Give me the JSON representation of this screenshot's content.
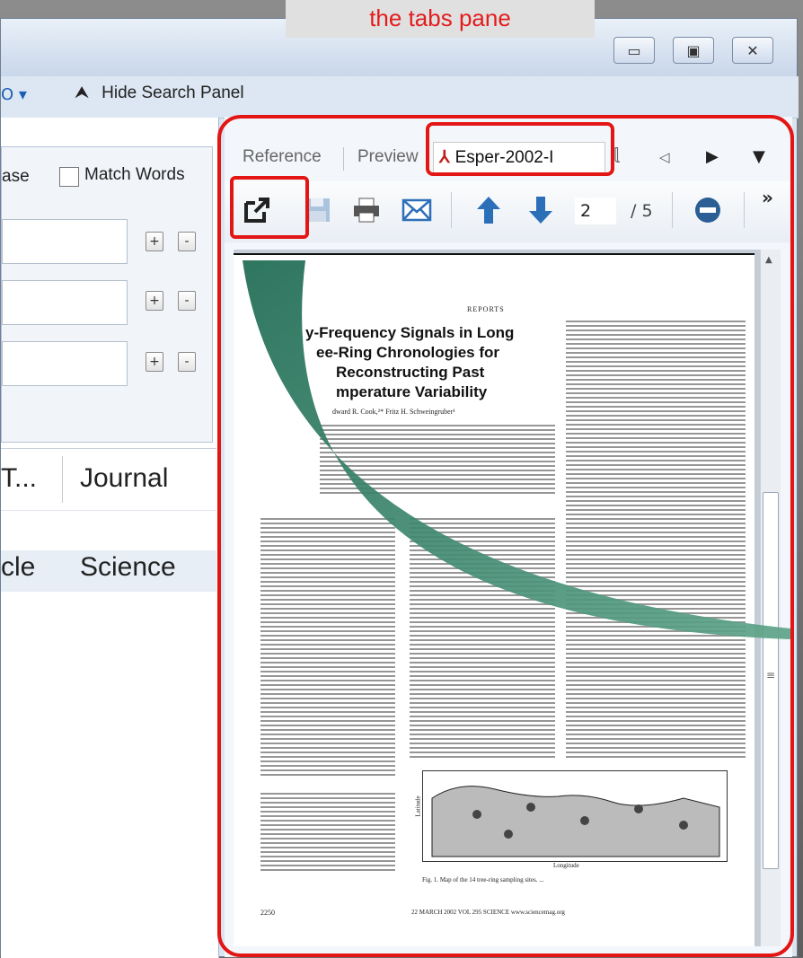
{
  "callout": {
    "text": "the tabs pane"
  },
  "window": {
    "controls": [
      "minimize",
      "restore",
      "close"
    ]
  },
  "searchbar": {
    "hide_label": "Hide Search Panel"
  },
  "search_options": {
    "partial_label": "ase",
    "match_words": "Match Words",
    "match_words_checked": false
  },
  "search_fields": [
    {
      "value": ""
    },
    {
      "value": ""
    },
    {
      "value": ""
    }
  ],
  "table": {
    "columns": [
      "T...",
      "Journal"
    ],
    "rows": [
      {
        "type": "cle",
        "journal": "Science"
      }
    ]
  },
  "tabs": [
    {
      "label": "Reference",
      "active": false
    },
    {
      "label": "Preview",
      "active": false
    },
    {
      "label": "Esper-2002-I",
      "active": true
    }
  ],
  "toolbar": {
    "open_external": "open-external-icon",
    "save": "save-icon",
    "print": "print-icon",
    "email": "email-icon",
    "prev": "arrow-up-icon",
    "next": "arrow-down-icon",
    "page_current": "2",
    "page_total": "/ 5",
    "more": "»"
  },
  "pdf": {
    "section": "REPORTS",
    "title_lines": [
      "y-Frequency Signals in Long",
      "ee-Ring Chronologies for",
      "Reconstructing Past",
      "mperature Variability"
    ],
    "authors": "dward R. Cook,²* Fritz H. Schweingruber¹",
    "footer_page": "2250",
    "footer_text": "22 MARCH 2002   VOL 295   SCIENCE   www.sciencemag.org",
    "figure_xlabel": "Longitude",
    "figure_ylabel": "Latitude",
    "figure_caption": "Fig. 1. Map of the 14 tree-ring sampling sites. ..."
  },
  "colors": {
    "highlight": "#e31515",
    "arrow": "#2a7a60"
  }
}
